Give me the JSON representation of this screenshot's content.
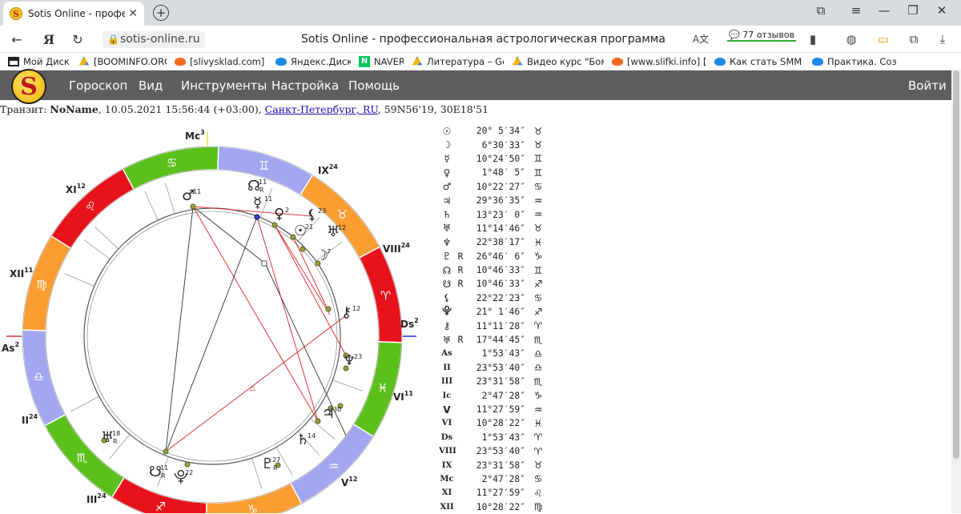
{
  "browser": {
    "tab_title": "Sotis Online - професси",
    "url": "sotis-online.ru",
    "page_title": "Sotis Online - профессиональная астрологическая программа",
    "reviews": "77 отзывов",
    "bookmarks": [
      {
        "label": "Мой Диск",
        "icon": "drive-icon",
        "color": "#222"
      },
      {
        "label": "[BOOMINFO.ORG]",
        "icon": "google-drive-icon",
        "color": "#f4b400"
      },
      {
        "label": "[slivysklad.com] [Д",
        "icon": "cloud-icon",
        "color": "#f26b21"
      },
      {
        "label": "Яндекс.Диск",
        "icon": "yadisk-icon",
        "color": "#1e88e5"
      },
      {
        "label": "NAVER",
        "icon": "naver-icon",
        "color": "#03c75a"
      },
      {
        "label": "Литература – Goo",
        "icon": "google-drive-icon",
        "color": "#f4b400"
      },
      {
        "label": "Видео курс \"Бомб",
        "icon": "google-drive-icon",
        "color": "#f4b400"
      },
      {
        "label": "[www.slifki.info] [А",
        "icon": "cloud-icon",
        "color": "#f26b21"
      },
      {
        "label": "Как стать SMM спе",
        "icon": "yadisk-icon",
        "color": "#1e88e5"
      },
      {
        "label": "Практика. Соз",
        "icon": "yadisk-icon",
        "color": "#1e88e5"
      }
    ]
  },
  "site": {
    "logo_letter": "S",
    "menu": [
      "Гороскоп",
      "Вид",
      "Инструменты",
      "Настройка",
      "Помощь"
    ],
    "login": "Войти"
  },
  "transit": {
    "prefix": "Транзит:",
    "name": "NoName",
    "datetime": ", 10.05.2021 15:56:44 (+03:00), ",
    "city": "Санкт-Петербург, RU",
    "coords": ", 59N56'19, 30E18'51"
  },
  "chart_labels": {
    "mc": "Mc",
    "mc_num": "3",
    "ds": "Ds",
    "ds_num": "2",
    "as": "As",
    "as_num": "2",
    "houses": [
      {
        "roman": "IX",
        "num": "24"
      },
      {
        "roman": "VIII",
        "num": "24"
      },
      {
        "roman": "VI",
        "num": "11"
      },
      {
        "roman": "V",
        "num": "12"
      },
      {
        "roman": "III",
        "num": "24"
      },
      {
        "roman": "II",
        "num": "24"
      },
      {
        "roman": "XII",
        "num": "11"
      },
      {
        "roman": "XI",
        "num": "12"
      }
    ]
  },
  "planets": [
    {
      "sym": "☉",
      "retro": "",
      "deg": "20° 5′34″",
      "sign": "♉"
    },
    {
      "sym": "☽",
      "retro": "",
      "deg": "6°30′33″",
      "sign": "♉"
    },
    {
      "sym": "☿",
      "retro": "",
      "deg": "10°24′50″",
      "sign": "♊"
    },
    {
      "sym": "♀",
      "retro": "",
      "deg": "1°48′ 5″",
      "sign": "♊"
    },
    {
      "sym": "♂",
      "retro": "",
      "deg": "10°22′27″",
      "sign": "♋"
    },
    {
      "sym": "♃",
      "retro": "",
      "deg": "29°36′35″",
      "sign": "♒"
    },
    {
      "sym": "♄",
      "retro": "",
      "deg": "13°23′ 0″",
      "sign": "♒"
    },
    {
      "sym": "♅",
      "retro": "",
      "deg": "11°14′46″",
      "sign": "♉"
    },
    {
      "sym": "♆",
      "retro": "",
      "deg": "22°38′17″",
      "sign": "♓"
    },
    {
      "sym": "♇",
      "retro": "R",
      "deg": "26°46′ 6″",
      "sign": "♑"
    },
    {
      "sym": "☊",
      "retro": "R",
      "deg": "10°46′33″",
      "sign": "♊"
    },
    {
      "sym": "☋",
      "retro": "R",
      "deg": "10°46′33″",
      "sign": "♐"
    },
    {
      "sym": "⚸",
      "retro": "",
      "deg": "22°22′23″",
      "sign": "♋"
    },
    {
      "sym": "⯓",
      "retro": "",
      "deg": "21° 1′46″",
      "sign": "♐"
    },
    {
      "sym": "⚷",
      "retro": "",
      "deg": "11°11′28″",
      "sign": "♈"
    },
    {
      "sym": "♅",
      "retro": "R",
      "deg": "17°44′45″",
      "sign": "♏"
    },
    {
      "sym": "As",
      "retro": "",
      "deg": "1°53′43″",
      "sign": "♎"
    },
    {
      "sym": "II",
      "retro": "",
      "deg": "23°53′40″",
      "sign": "♎"
    },
    {
      "sym": "III",
      "retro": "",
      "deg": "23°31′58″",
      "sign": "♏"
    },
    {
      "sym": "Ic",
      "retro": "",
      "deg": "2°47′28″",
      "sign": "♑"
    },
    {
      "sym": "V",
      "retro": "",
      "deg": "11°27′59″",
      "sign": "♒"
    },
    {
      "sym": "VI",
      "retro": "",
      "deg": "10°28′22″",
      "sign": "♓"
    },
    {
      "sym": "Ds",
      "retro": "",
      "deg": "1°53′43″",
      "sign": "♈"
    },
    {
      "sym": "VIII",
      "retro": "",
      "deg": "23°53′40″",
      "sign": "♈"
    },
    {
      "sym": "IX",
      "retro": "",
      "deg": "23°31′58″",
      "sign": "♉"
    },
    {
      "sym": "Mc",
      "retro": "",
      "deg": "2°47′28″",
      "sign": "♋"
    },
    {
      "sym": "XI",
      "retro": "",
      "deg": "11°27′59″",
      "sign": "♌"
    },
    {
      "sym": "XII",
      "retro": "",
      "deg": "10°28′22″",
      "sign": "♍"
    }
  ],
  "chart_planets": [
    {
      "glyph": "♂",
      "sup": "11",
      "retro": ""
    },
    {
      "glyph": "☊",
      "sup": "11",
      "retro": "R"
    },
    {
      "glyph": "☿",
      "sup": "11",
      "retro": ""
    },
    {
      "glyph": "♀",
      "sup": "2",
      "retro": ""
    },
    {
      "glyph": "⚸",
      "sup": "23",
      "retro": ""
    },
    {
      "glyph": "☉",
      "sup": "21",
      "retro": ""
    },
    {
      "glyph": "♅",
      "sup": "12",
      "retro": ""
    },
    {
      "glyph": "☽",
      "sup": "7",
      "retro": ""
    },
    {
      "glyph": "⚷",
      "sup": "12",
      "retro": ""
    },
    {
      "glyph": "♆",
      "sup": "23",
      "retro": ""
    },
    {
      "glyph": "♃",
      "sup": "30",
      "retro": ""
    },
    {
      "glyph": "♄",
      "sup": "14",
      "retro": ""
    },
    {
      "glyph": "♇",
      "sup": "27",
      "retro": "R"
    },
    {
      "glyph": "⯓",
      "sup": "22",
      "retro": ""
    },
    {
      "glyph": "☋",
      "sup": "11",
      "retro": "R"
    },
    {
      "glyph": "♅",
      "sup": "18",
      "retro": "R"
    }
  ],
  "colors": {
    "fire": "#e8121b",
    "earth": "#5cc01c",
    "air": "#a3a6f0",
    "water": "#fb9d30",
    "nav_bg": "#5e5e5e"
  }
}
